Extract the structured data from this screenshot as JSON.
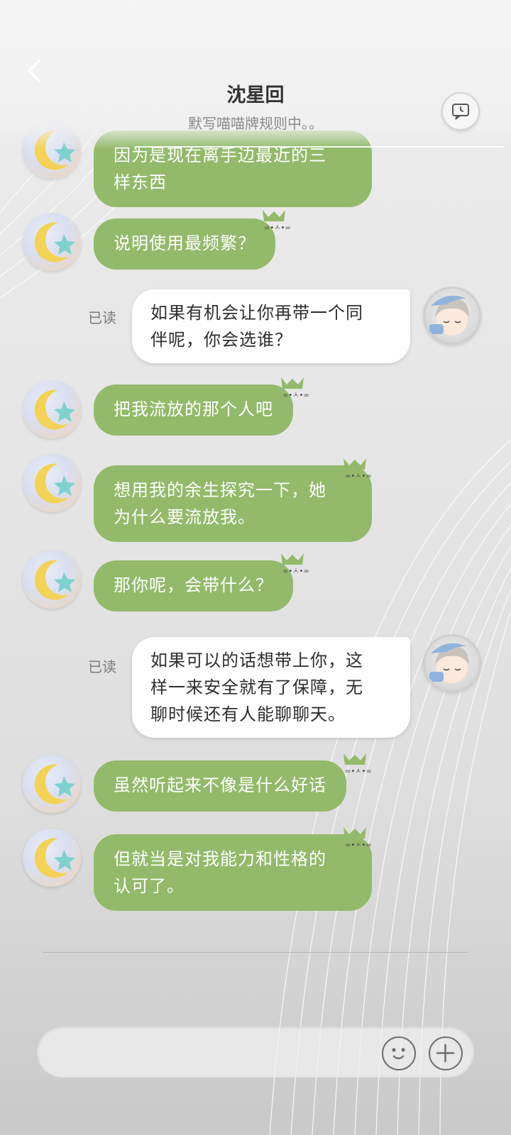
{
  "header": {
    "title": "沈星回",
    "subtitle": "默写喵喵牌规则中。。"
  },
  "messages": [
    {
      "side": "left",
      "text": "因为是现在离手边最近的三样东西",
      "lines": [
        "因为是现在离手边最近的三",
        "样东西"
      ]
    },
    {
      "side": "left",
      "text": "说明使用最频繁？"
    },
    {
      "side": "right",
      "read_label": "已读",
      "lines": [
        "如果有机会让你再带一个同",
        "伴呢，你会选谁？"
      ]
    },
    {
      "side": "left",
      "text": "把我流放的那个人吧"
    },
    {
      "side": "left",
      "lines": [
        "想用我的余生探究一下，她",
        "为什么要流放我。"
      ]
    },
    {
      "side": "left",
      "text": "那你呢，会带什么？"
    },
    {
      "side": "right",
      "read_label": "已读",
      "lines": [
        "如果可以的话想带上你，这",
        "样一来安全就有了保障，无",
        "聊时候还有人能聊聊天。"
      ]
    },
    {
      "side": "left",
      "text": "虽然听起来不像是什么好话"
    },
    {
      "side": "left",
      "lines": [
        "但就当是对我能力和性格的",
        "认可了。"
      ]
    }
  ],
  "colors": {
    "bubble_green": "#92ba6a",
    "bubble_white": "#ffffff",
    "background": "#e6e6e6"
  },
  "icons": {
    "back": "chevron-left-icon",
    "history": "chat-history-icon",
    "emoji": "smiley-icon",
    "plus": "plus-icon"
  }
}
